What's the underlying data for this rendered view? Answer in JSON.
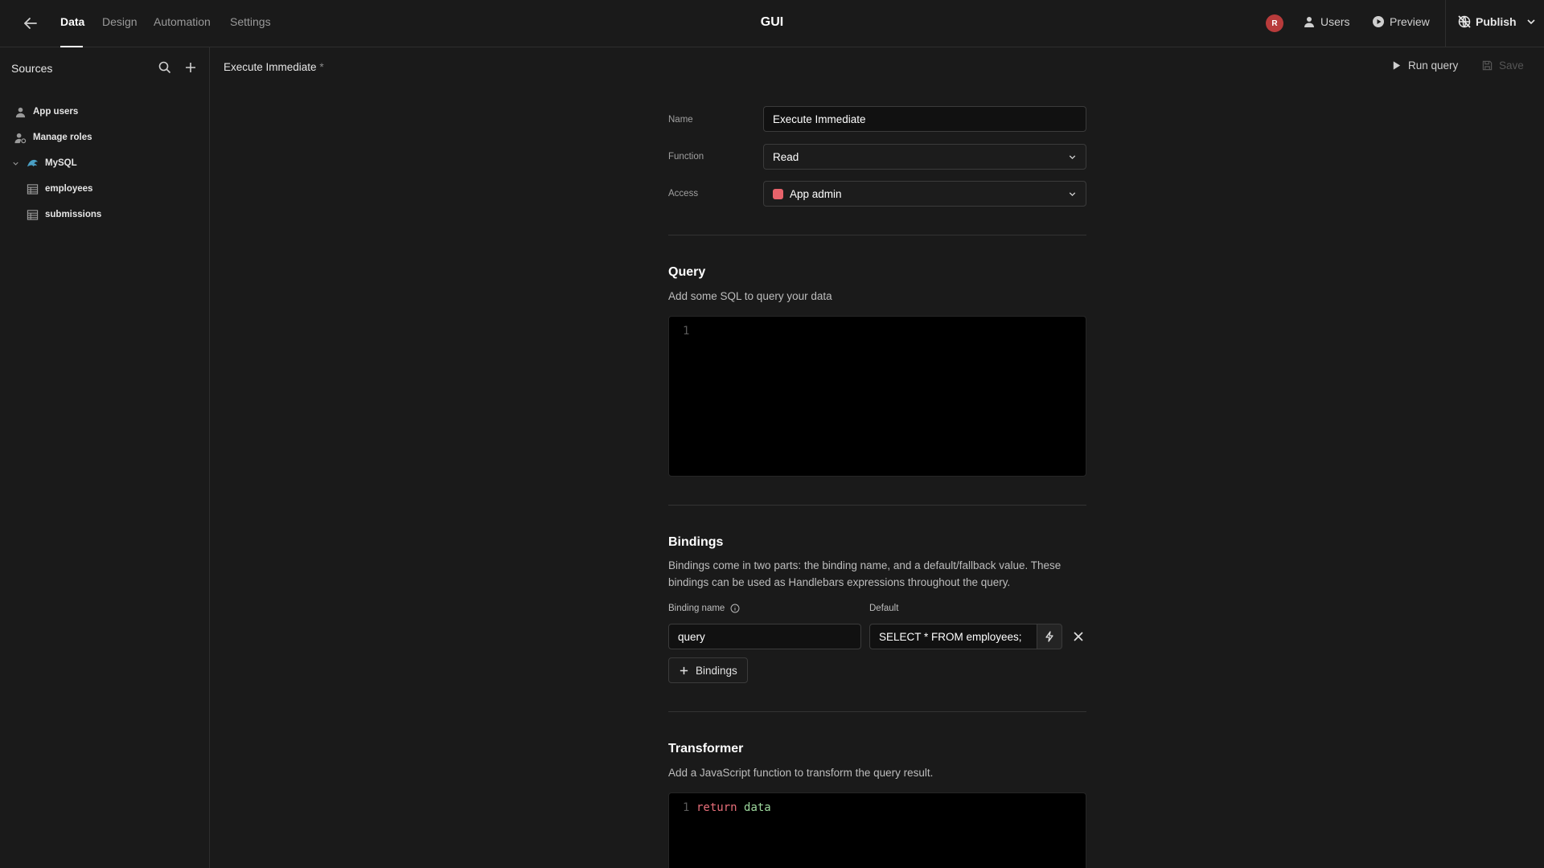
{
  "topbar": {
    "tabs": [
      {
        "label": "Data",
        "active": true
      },
      {
        "label": "Design",
        "active": false
      },
      {
        "label": "Automation",
        "active": false
      },
      {
        "label": "Settings",
        "active": false
      }
    ],
    "app_title": "GUI",
    "avatar_initial": "R",
    "users_label": "Users",
    "preview_label": "Preview",
    "publish_label": "Publish"
  },
  "sidebar": {
    "title": "Sources",
    "items": [
      {
        "label": "App users",
        "icon": "user-icon"
      },
      {
        "label": "Manage roles",
        "icon": "user-gear-icon"
      },
      {
        "label": "MySQL",
        "icon": "mysql-icon",
        "expanded": true
      },
      {
        "label": "employees",
        "icon": "table-icon"
      },
      {
        "label": "submissions",
        "icon": "table-icon"
      }
    ]
  },
  "content": {
    "title": "Execute Immediate",
    "unsaved_marker": "*",
    "run_query_label": "Run query",
    "save_label": "Save"
  },
  "form": {
    "name_label": "Name",
    "name_value": "Execute Immediate",
    "function_label": "Function",
    "function_value": "Read",
    "access_label": "Access",
    "access_value": "App admin",
    "access_color": "#e8636b"
  },
  "query": {
    "title": "Query",
    "description": "Add some SQL to query your data",
    "line_number": "1",
    "code": ""
  },
  "bindings": {
    "title": "Bindings",
    "description": "Bindings come in two parts: the binding name, and a default/fallback value. These bindings can be used as Handlebars expressions throughout the query.",
    "name_header": "Binding name",
    "default_header": "Default",
    "rows": [
      {
        "name": "query",
        "default": "SELECT * FROM employees;"
      }
    ],
    "add_label": "Bindings"
  },
  "transformer": {
    "title": "Transformer",
    "description": "Add a JavaScript function to transform the query result.",
    "line_number": "1",
    "keyword": "return",
    "identifier": "data"
  }
}
